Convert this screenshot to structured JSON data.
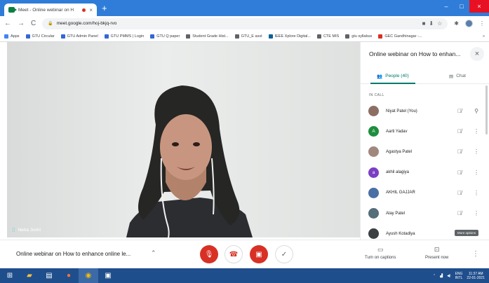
{
  "browser": {
    "tab_title": "Meet - Online webinar on H",
    "tab_close": "×",
    "new_tab": "+",
    "url": "meet.google.com/hoj-bkjq-rvo",
    "window_controls": [
      "–",
      "□",
      "×"
    ],
    "nav": [
      "←",
      "→",
      "C"
    ],
    "bookmarks": [
      {
        "label": "Apps",
        "color": "#4285f4"
      },
      {
        "label": "GTU Circular",
        "color": "#3367d6"
      },
      {
        "label": "GTU Admin Panel",
        "color": "#3367d6"
      },
      {
        "label": "GTU PMMS | Login",
        "color": "#3367d6"
      },
      {
        "label": "GTU Q paper",
        "color": "#3367d6"
      },
      {
        "label": "Student Grade Hist...",
        "color": "#5f6368"
      },
      {
        "label": "GTU_E asst",
        "color": "#5f6368"
      },
      {
        "label": "IEEE Xplore Digital...",
        "color": "#00629b"
      },
      {
        "label": "CTE MIS",
        "color": "#5f6368"
      },
      {
        "label": "gtu syllabus",
        "color": "#5f6368"
      },
      {
        "label": "GEC Gandhinagar -...",
        "color": "#d93025"
      }
    ],
    "bookmarks_more": "»"
  },
  "video": {
    "presenter_name": "Neha Joshi"
  },
  "panel": {
    "title": "Online webinar on How to enhan...",
    "close": "×",
    "tab_people": "People (40)",
    "tab_chat": "Chat",
    "section": "IN CALL",
    "participants": [
      {
        "name": "Niyat Patel (You)",
        "initial": "",
        "color": "#8d6e63",
        "action": "pin"
      },
      {
        "name": "Aarti Yadav",
        "initial": "A",
        "color": "#1e8e3e",
        "action": "more"
      },
      {
        "name": "Agastya Patel",
        "initial": "",
        "color": "#a1887f",
        "action": "more"
      },
      {
        "name": "akhil alagiya",
        "initial": "a",
        "color": "#7b3fc4",
        "action": "more"
      },
      {
        "name": "AKHIL GAJJAR",
        "initial": "",
        "color": "#4a6fa5",
        "action": "more"
      },
      {
        "name": "Alay Patel",
        "initial": "",
        "color": "#546e7a",
        "action": "more"
      },
      {
        "name": "Ayush Kotadiya",
        "initial": "",
        "color": "#3c4043",
        "action": "more"
      }
    ],
    "tooltip": "More options"
  },
  "bottom": {
    "meeting_title": "Online webinar on How to enhance online le...",
    "captions_label": "Turn on captions",
    "present_label": "Present now"
  },
  "taskbar": {
    "lang": "ENG",
    "lang2": "INTL",
    "time": "11:37 AM",
    "date": "22-01-2021"
  },
  "colors": {
    "accent": "#00796b",
    "danger": "#d93025",
    "taskbar": "#1f4e8c",
    "tabstrip": "#2f7dd8"
  }
}
